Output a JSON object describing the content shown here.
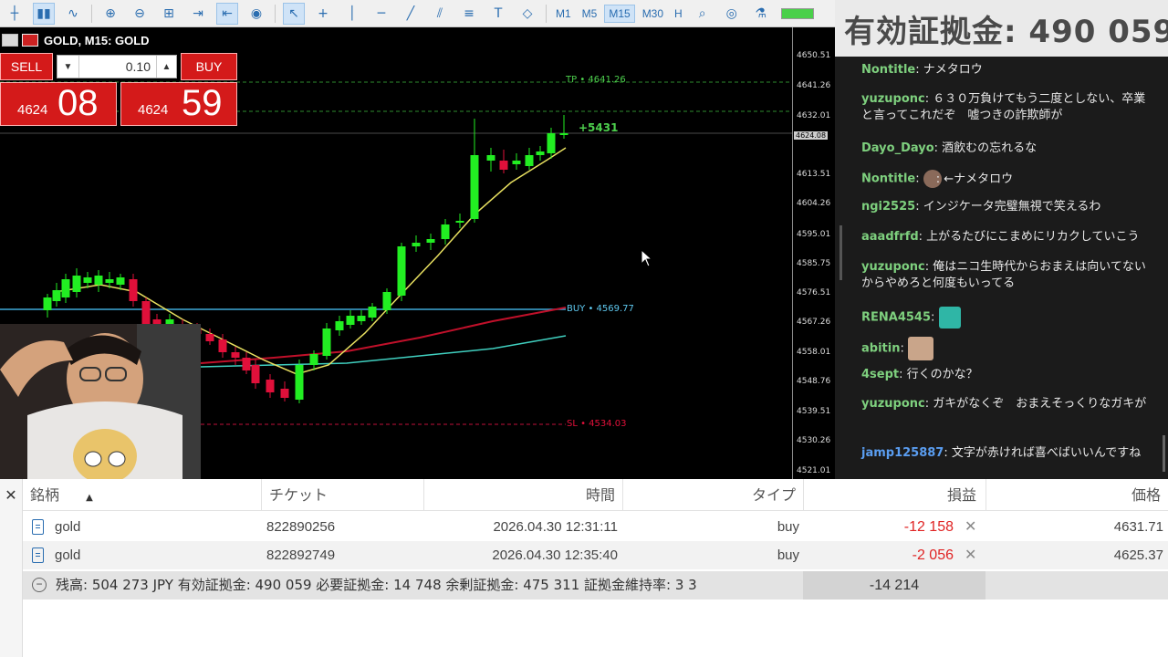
{
  "toolbar": {
    "timeframes": [
      "M1",
      "M5",
      "M15",
      "M30",
      "H"
    ],
    "active_timeframe": "M15"
  },
  "overlay": {
    "margin_text": "有効証拠金: 490 059"
  },
  "chart": {
    "title": "GOLD, M15: GOLD",
    "tp_label": "TP • 4641.26",
    "profit_label": "+5431",
    "buy_label": "BUY • 4569.77",
    "sl_label": "SL • 4534.03",
    "current_price": "4624.08",
    "price_axis": [
      "4650.51",
      "4641.26",
      "4632.01",
      "4613.51",
      "4604.26",
      "4595.01",
      "4585.75",
      "4576.51",
      "4567.26",
      "4558.01",
      "4548.76",
      "4539.51",
      "4530.26",
      "4521.01"
    ]
  },
  "oneclick": {
    "sell_label": "SELL",
    "buy_label": "BUY",
    "lot": "0.10",
    "sell_price_small": "4624",
    "sell_price_big": "08",
    "buy_price_small": "4624",
    "buy_price_big": "59"
  },
  "chat": {
    "messages": [
      {
        "name": "Nontitle",
        "text": ": ナメタロウ"
      },
      {
        "name": "yuzuponc",
        "text": ": ６３０万負けてもう二度としない、卒業と言ってこれだぞ　嘘つきの詐欺師が"
      },
      {
        "name": "Dayo_Dayo",
        "text": ": 酒飲むの忘れるな"
      },
      {
        "name": "Nontitle",
        "text": ": ←ナメタロウ"
      },
      {
        "name": "ngi2525",
        "text": ": インジケータ完璧無視で笑えるわ"
      },
      {
        "name": "aaadfrfd",
        "text": ": 上がるたびにこまめにリカクしていこう"
      },
      {
        "name": "yuzuponc",
        "text": ": 俺はニコ生時代からおまえは向いてないからやめろと何度もいってる"
      },
      {
        "name": "RENA4545",
        "text": ":"
      },
      {
        "name": "abitin",
        "text": ":"
      },
      {
        "name": "4sept",
        "text": ": 行くのかな？"
      },
      {
        "name": "yuzuponc",
        "text": ": ガキがなくぞ　おまえそっくりなガキが"
      },
      {
        "name": "jamp125887",
        "text": ": 文字が赤ければ喜べばいいんですね"
      }
    ]
  },
  "terminal": {
    "headers": [
      "銘柄",
      "チケット",
      "時間",
      "タイプ",
      "損益",
      "価格"
    ],
    "rows": [
      {
        "symbol": "gold",
        "ticket": "822890256",
        "time": "2026.04.30 12:31:11",
        "type": "buy",
        "profit": "-12 158",
        "price": "4631.71"
      },
      {
        "symbol": "gold",
        "ticket": "822892749",
        "time": "2026.04.30 12:35:40",
        "type": "buy",
        "profit": "-2 056",
        "price": "4625.37"
      }
    ],
    "summary": "残高: 504 273 JPY  有効証拠金: 490 059  必要証拠金: 14 748  余剰証拠金: 475 311  証拠金維持率: 3 3",
    "total": "-14 214"
  },
  "colors": {
    "bull": "#22ee22",
    "bear": "#e0103a",
    "sell_buy_button": "#d41a1a",
    "negative": "#e02424"
  }
}
